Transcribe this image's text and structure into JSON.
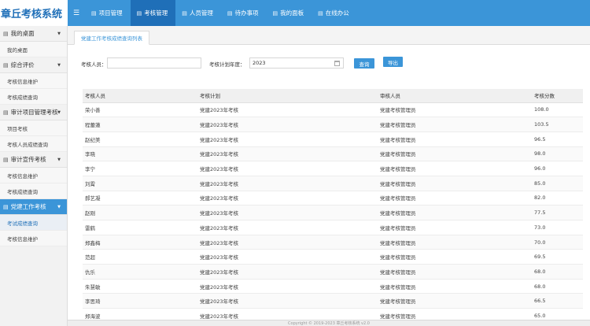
{
  "app": {
    "title": "章丘考核系统"
  },
  "topnav": [
    {
      "label": "项目管理",
      "icon": "list-icon",
      "active": false
    },
    {
      "label": "考核管理",
      "icon": "list-icon",
      "active": true
    },
    {
      "label": "人员管理",
      "icon": "list-icon",
      "active": false
    },
    {
      "label": "待办事项",
      "icon": "list-icon",
      "active": false
    },
    {
      "label": "我的面板",
      "icon": "list-icon",
      "active": false
    },
    {
      "label": "在线办公",
      "icon": "list-icon",
      "active": false
    }
  ],
  "sidebar": {
    "groups": [
      {
        "label": "我的桌面",
        "active": false,
        "items": [
          {
            "label": "我的桌面",
            "active": false
          }
        ]
      },
      {
        "label": "综合评价",
        "active": false,
        "items": [
          {
            "label": "考核信息维护",
            "active": false
          },
          {
            "label": "考核成绩查询",
            "active": false
          }
        ]
      },
      {
        "label": "审计项目管理考核",
        "active": false,
        "items": [
          {
            "label": "项目考核",
            "active": false
          },
          {
            "label": "考核人员成绩查询",
            "active": false
          }
        ]
      },
      {
        "label": "审计宣传考核",
        "active": false,
        "items": [
          {
            "label": "考核信息维护",
            "active": false
          },
          {
            "label": "考核成绩查询",
            "active": false
          }
        ]
      },
      {
        "label": "党建工作考核",
        "active": true,
        "items": [
          {
            "label": "考试成绩查询",
            "active": true
          },
          {
            "label": "考核信息维护",
            "active": false
          }
        ]
      }
    ]
  },
  "tab": {
    "label": "党建工作考核成绩查询列表"
  },
  "filter": {
    "person_label": "考核人员：",
    "person_value": "",
    "year_label": "考核计划年度：",
    "year_value": "2023",
    "query_button": "查询",
    "export_button": "导出"
  },
  "table": {
    "headers": [
      "考核人员",
      "考核计划",
      "审核人员",
      "考核分数"
    ],
    "rows": [
      [
        "荣小善",
        "党建2023年考核",
        "党建考核管理员",
        "108.0"
      ],
      [
        "程蕾蓮",
        "党建2023年考核",
        "党建考核管理员",
        "103.5"
      ],
      [
        "赵纪美",
        "党建2023年考核",
        "党建考核管理员",
        "96.5"
      ],
      [
        "李晓",
        "党建2023年考核",
        "党建考核管理员",
        "98.0"
      ],
      [
        "李宁",
        "党建2023年考核",
        "党建考核管理员",
        "96.0"
      ],
      [
        "刘霄",
        "党建2023年考核",
        "党建考核管理员",
        "85.0"
      ],
      [
        "郝艺凝",
        "党建2023年考核",
        "党建考核管理员",
        "82.0"
      ],
      [
        "赵刚",
        "党建2023年考核",
        "党建考核管理员",
        "77.5"
      ],
      [
        "雷鹤",
        "党建2023年考核",
        "党建考核管理员",
        "73.0"
      ],
      [
        "郑鑫梅",
        "党建2023年考核",
        "党建考核管理员",
        "70.0"
      ],
      [
        "范超",
        "党建2023年考核",
        "党建考核管理员",
        "69.5"
      ],
      [
        "仇乐",
        "党建2023年考核",
        "党建考核管理员",
        "68.0"
      ],
      [
        "朱慧敏",
        "党建2023年考核",
        "党建考核管理员",
        "68.0"
      ],
      [
        "李思琦",
        "党建2023年考核",
        "党建考核管理员",
        "66.5"
      ],
      [
        "郑海波",
        "党建2023年考核",
        "党建考核管理员",
        "65.0"
      ]
    ]
  },
  "footer": {
    "text": "Copyright © 2019-2023 章丘考核系统 v2.0"
  },
  "colors": {
    "primary": "#3b95d8",
    "primary_dark": "#1f6fb8",
    "brand_text": "#1f6fb8"
  }
}
